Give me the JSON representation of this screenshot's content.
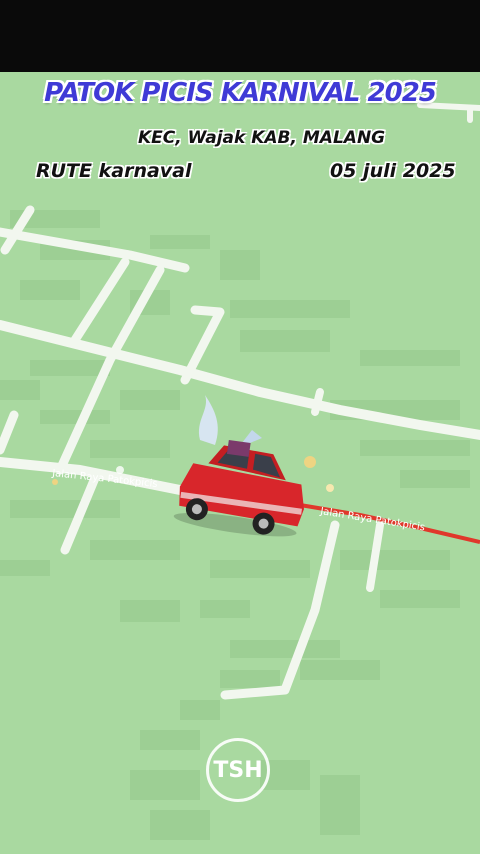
{
  "overlay": {
    "title": "PATOK PICIS KARNIVAL 2025",
    "location": "KEC, Wajak  KAB, MALANG",
    "route_label": "RUTE karnaval",
    "date": "05 juli 2025"
  },
  "map": {
    "street_label_left": "Jalan Raya Patokpicis",
    "street_label_right": "Jalan Raya Patokpicis",
    "route_color": "#e0382b",
    "road_color": "#f2f7ef",
    "base_color": "#a9d9a0"
  },
  "vehicle": {
    "icon": "red-car-icon"
  },
  "watermark": {
    "text": "TSH"
  }
}
